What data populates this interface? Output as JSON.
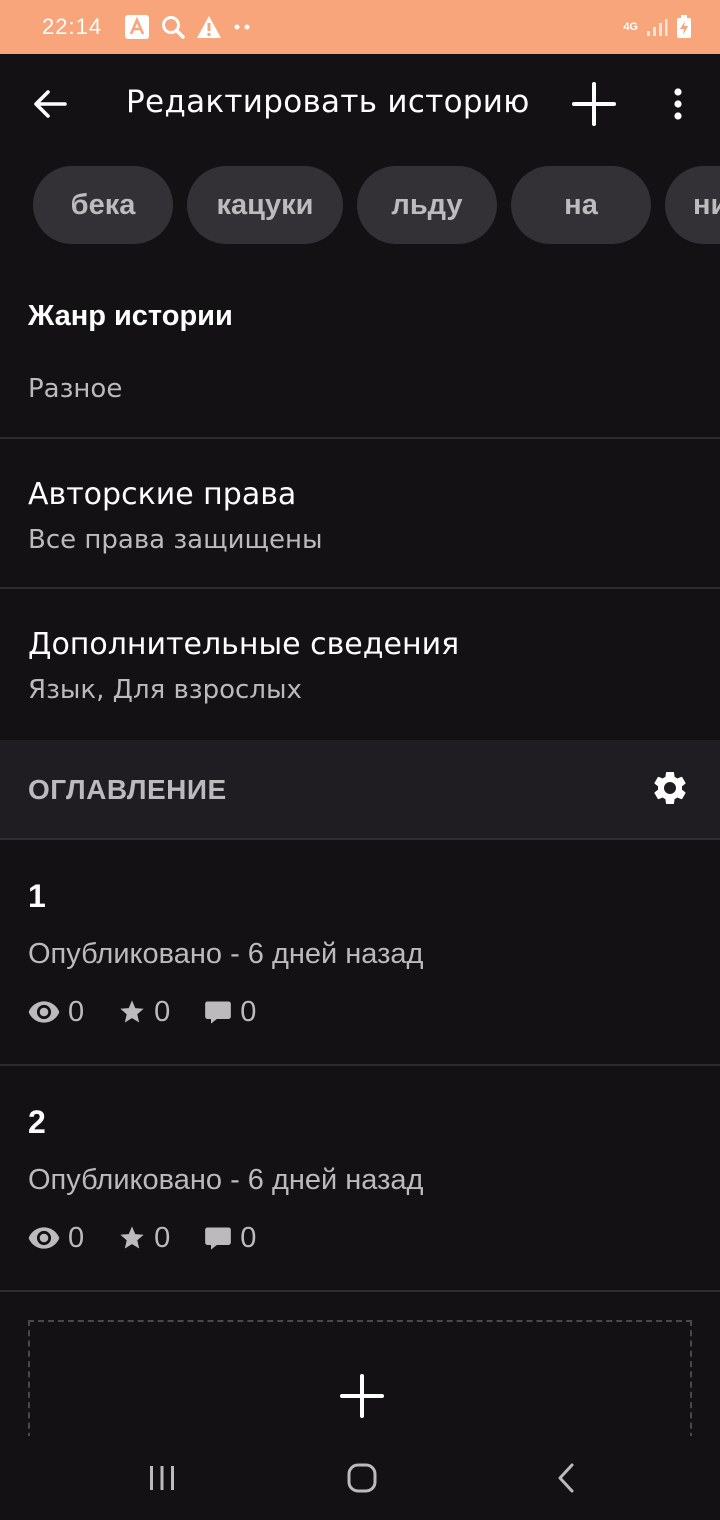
{
  "status_bar": {
    "time": "22:14",
    "network": "4G",
    "icons": [
      "a-notification-icon",
      "search-icon",
      "warning-icon",
      "more-dots-icon",
      "signal-icon",
      "battery-charging-icon"
    ]
  },
  "app_bar": {
    "title": "Редактировать историю",
    "icons": [
      "arrow-back-icon",
      "plus-icon",
      "more-vert-icon"
    ]
  },
  "tags": [
    "бека",
    "кацуки",
    "льду",
    "на",
    "ни"
  ],
  "genre": {
    "title": "Жанр истории",
    "value": "Разное"
  },
  "copyright": {
    "title": "Авторские права",
    "value": "Все права защищены"
  },
  "details": {
    "title": "Дополнительные сведения",
    "value": "Язык, Для взрослых"
  },
  "toc": {
    "title": "ОГЛАВЛЕНИЕ",
    "icon": "gear-icon"
  },
  "chapters": [
    {
      "number": "1",
      "status": "Опубликовано - 6 дней назад",
      "views": "0",
      "votes": "0",
      "comments": "0"
    },
    {
      "number": "2",
      "status": "Опубликовано - 6 дней назад",
      "views": "0",
      "votes": "0",
      "comments": "0"
    }
  ],
  "colors": {
    "status_bar": "#f9a57b",
    "background": "#131114",
    "tag_bg": "#333135",
    "section_header_bg": "#1f1d21",
    "secondary_text": "#bcbabd"
  }
}
